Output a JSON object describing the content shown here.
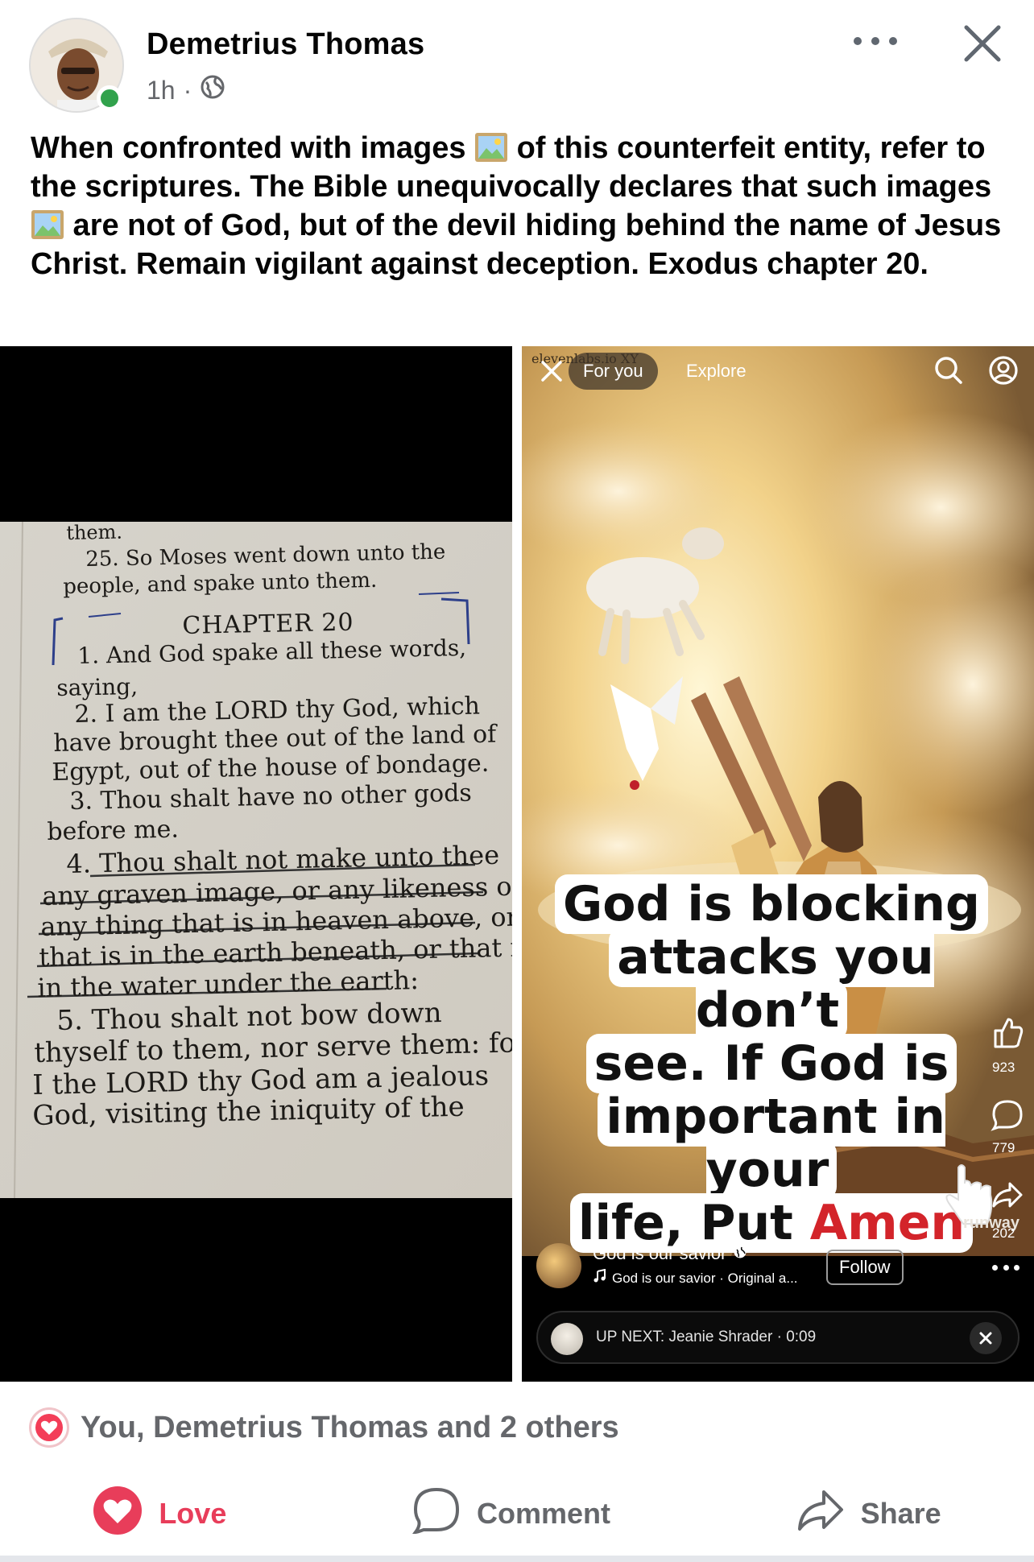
{
  "post": {
    "author_name": "Demetrius Thomas",
    "time": "1h",
    "separator": "·",
    "body_parts": [
      "When confronted with images ",
      " of this counterfeit entity, refer to the scriptures. The Bible unequivocally declares that such images ",
      " are not of God, but of the devil hiding behind the name of Jesus Christ. Remain vigilant against deception. Exodus chapter 20."
    ]
  },
  "left_image": {
    "lines": [
      "them.",
      "25. So Moses went down unto the",
      "people, and spake unto them.",
      "CHAPTER 20",
      "1. And God spake all these words,",
      "saying,",
      "2. I am the LORD thy God, which",
      "have brought thee out of the land of",
      "Egypt, out of the house of bondage.",
      "3. Thou shalt have no other gods",
      "before me.",
      "4. Thou shalt not make unto thee",
      "any graven image, or any likeness of",
      "any thing that is in heaven above, or",
      "that is in the earth beneath, or that is",
      "in the water under the earth:",
      "5. Thou shalt not bow down",
      "thyself to them, nor serve them: for",
      "I the LORD thy God am a jealous",
      "God, visiting the iniquity of the"
    ]
  },
  "right_image": {
    "watermark": "elevenlabs.io XY",
    "tab_for_you": "For you",
    "tab_explore": "Explore",
    "caption_lines": [
      "God is blocking",
      "attacks you don’t",
      "see. If God is",
      "important in your",
      "life, Put "
    ],
    "caption_highlight": "Amen",
    "like_count": "923",
    "comment_count": "779",
    "share_count": "202",
    "runway_mark": "runway",
    "account_name": "God is our savior",
    "audio_text": "God is our savior · Original a...",
    "follow_label": "Follow",
    "up_next": "UP NEXT: Jeanie Shrader · 0:09"
  },
  "reactions": {
    "summary": "You, Demetrius Thomas and 2 others"
  },
  "actions": {
    "love": "Love",
    "comment": "Comment",
    "share": "Share"
  },
  "colors": {
    "love": "#e83d5a",
    "online": "#31a24c",
    "secondary_text": "#65676b"
  }
}
